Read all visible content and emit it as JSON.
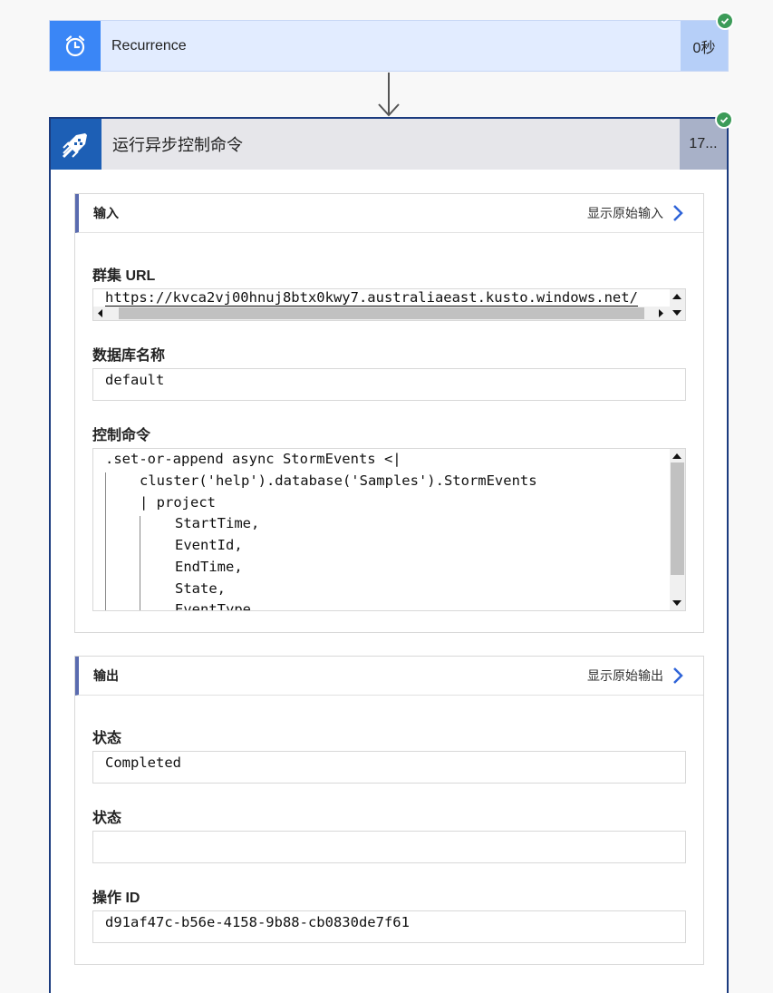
{
  "recurrence": {
    "title": "Recurrence",
    "duration": "0秒"
  },
  "action": {
    "title": "运行异步控制命令",
    "duration": "17..."
  },
  "inputs": {
    "title": "输入",
    "show_raw": "显示原始输入",
    "cluster_label": "群集 URL",
    "cluster_url": "https://kvca2vj00hnuj8btx0kwy7.australiaeast.kusto.windows.net/",
    "db_label": "数据库名称",
    "db_value": "default",
    "cmd_label": "控制命令",
    "cmd_lines": [
      ".set-or-append async StormEvents <|",
      "cluster('help').database('Samples').StormEvents",
      "| project",
      "StartTime,",
      "EventId,",
      "EndTime,",
      "State,",
      "EventType"
    ]
  },
  "outputs": {
    "title": "输出",
    "show_raw": "显示原始输出",
    "status_label": "状态",
    "status_value": "Completed",
    "status2_label": "状态",
    "status2_value": "",
    "opid_label": "操作 ID",
    "opid_value": "d91af47c-b56e-4158-9b88-cb0830de7f61"
  },
  "colors": {
    "recurrence_icon_bg": "#3a86f6",
    "action_icon_bg": "#1d5fb5",
    "success": "#3c9b58",
    "link_chevron": "#2f64d8"
  }
}
